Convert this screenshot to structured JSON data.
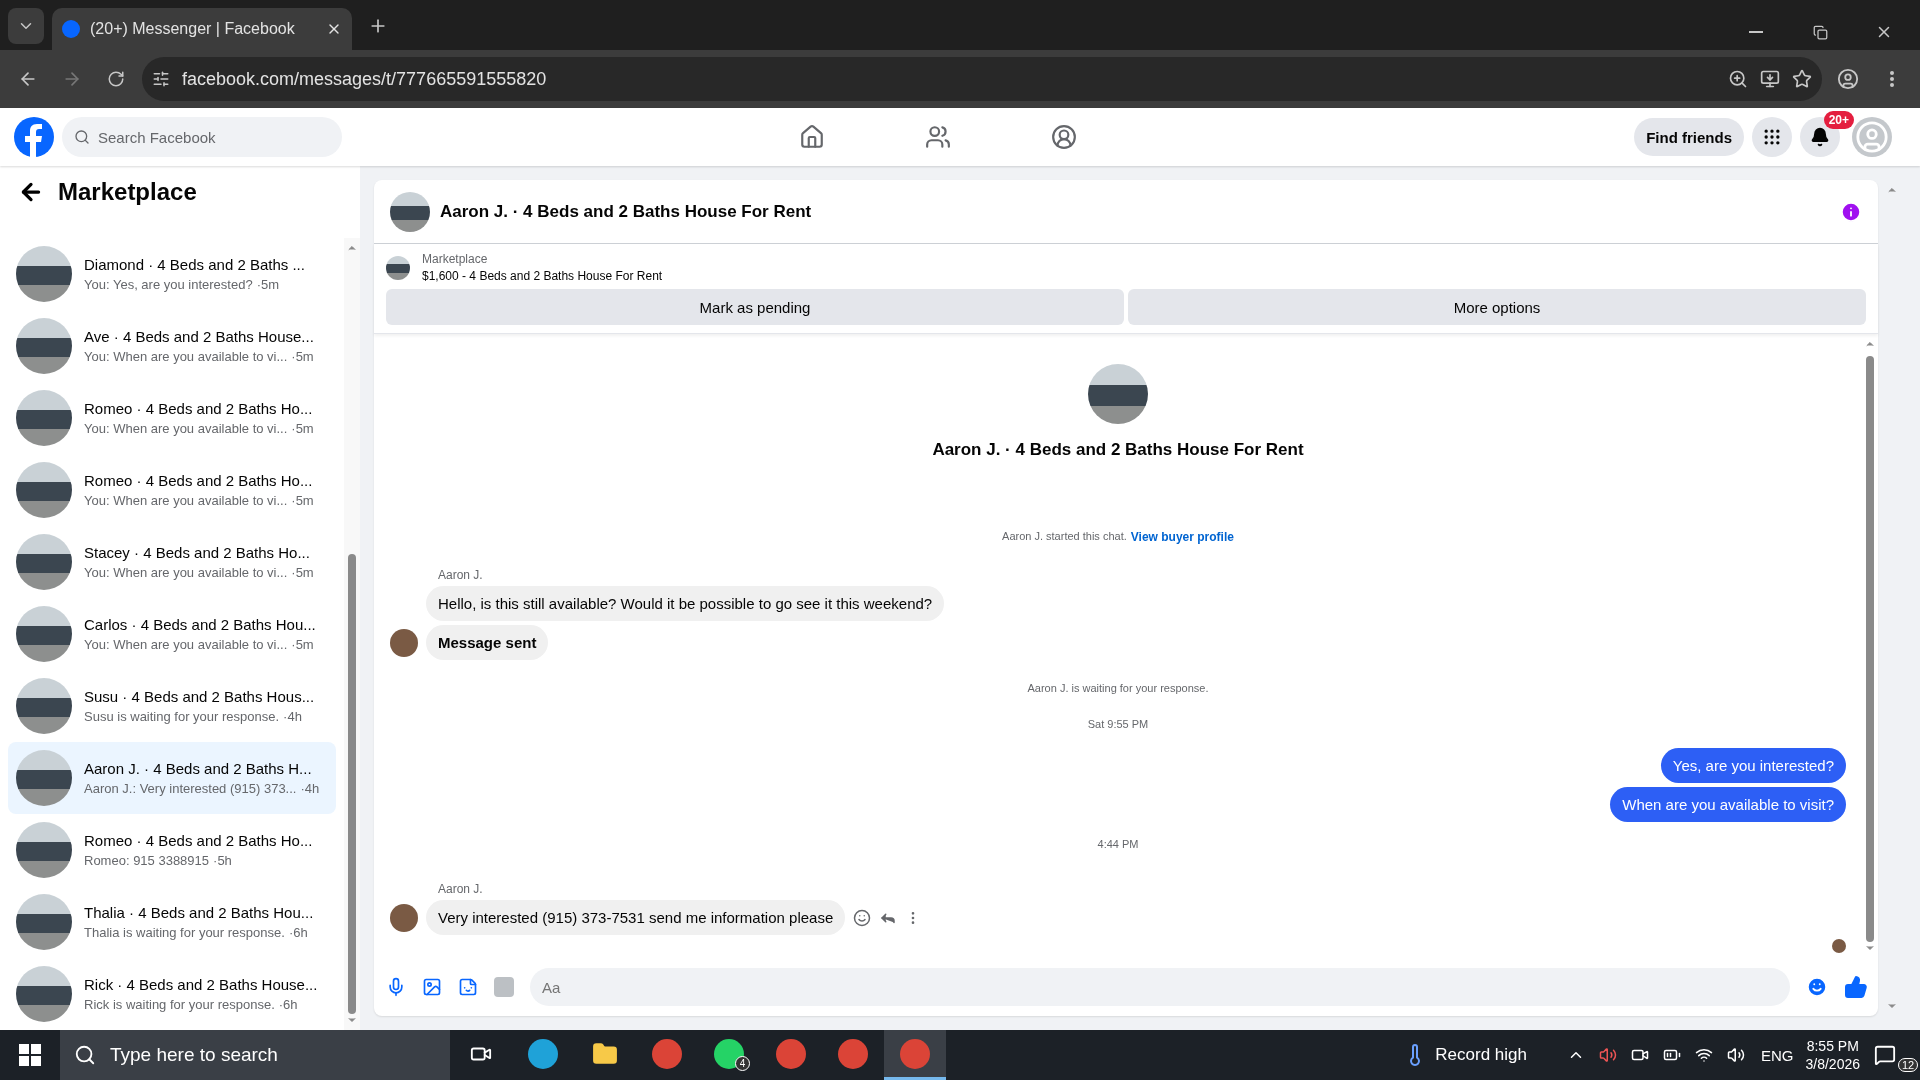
{
  "browser": {
    "tab_title": "(20+) Messenger | Facebook",
    "url": "facebook.com/messages/t/777665591555820"
  },
  "header": {
    "search_placeholder": "Search Facebook",
    "find_friends": "Find friends",
    "notification_badge": "20+"
  },
  "sidebar": {
    "title": "Marketplace",
    "conversations": [
      {
        "title": "Diamond · 4 Beds and 2 Baths ...",
        "preview": "You: Yes, are you interested?",
        "time": "·5m",
        "selected": false
      },
      {
        "title": "Ave · 4 Beds and 2 Baths House...",
        "preview": "You: When are you available to vi...",
        "time": "·5m",
        "selected": false
      },
      {
        "title": "Romeo · 4 Beds and 2 Baths Ho...",
        "preview": "You: When are you available to vi...",
        "time": "·5m",
        "selected": false
      },
      {
        "title": "Romeo · 4 Beds and 2 Baths Ho...",
        "preview": "You: When are you available to vi...",
        "time": "·5m",
        "selected": false
      },
      {
        "title": "Stacey · 4 Beds and 2 Baths Ho...",
        "preview": "You: When are you available to vi...",
        "time": "·5m",
        "selected": false
      },
      {
        "title": "Carlos · 4 Beds and 2 Baths Hou...",
        "preview": "You: When are you available to vi...",
        "time": "·5m",
        "selected": false
      },
      {
        "title": "Susu · 4 Beds and 2 Baths Hous...",
        "preview": "Susu is waiting for your response.",
        "time": "·4h",
        "selected": false
      },
      {
        "title": "Aaron J. · 4 Beds and 2 Baths H...",
        "preview": "Aaron J.: Very interested (915) 373...",
        "time": "·4h",
        "selected": true
      },
      {
        "title": "Romeo · 4 Beds and 2 Baths Ho...",
        "preview": "Romeo: 915 3388915",
        "time": "·5h",
        "selected": false
      },
      {
        "title": "Thalia · 4 Beds and 2 Baths Hou...",
        "preview": "Thalia is waiting for your response.",
        "time": "·6h",
        "selected": false
      },
      {
        "title": "Rick · 4 Beds and 2 Baths House...",
        "preview": "Rick is waiting for your response.",
        "time": "·6h",
        "selected": false
      }
    ]
  },
  "chat": {
    "title": "Aaron J. · 4 Beds and 2 Baths House For Rent",
    "listing": {
      "label": "Marketplace",
      "name": "$1,600 - 4 Beds and 2 Baths House For Rent"
    },
    "buttons": [
      "Mark as pending",
      "More options"
    ],
    "intro_title": "Aaron J. · 4 Beds and 2 Baths House For Rent",
    "messages": [
      {
        "kind": "intro",
        "text": "Aaron J. started this chat.",
        "link": "View buyer profile"
      },
      {
        "kind": "sender",
        "text": "Aaron J."
      },
      {
        "kind": "incoming",
        "text": "Hello, is this still available? Would it be possible to go see it this weekend?",
        "avatar": false,
        "bold": false,
        "actions": false
      },
      {
        "kind": "incoming",
        "text": "Message sent",
        "avatar": true,
        "bold": true,
        "actions": false
      },
      {
        "kind": "system",
        "text": "Aaron J. is waiting for your response."
      },
      {
        "kind": "time",
        "text": "Sat 9:55 PM"
      },
      {
        "kind": "outgoing",
        "text": "Yes, are you interested?"
      },
      {
        "kind": "outgoing",
        "text": "When are you available to visit?"
      },
      {
        "kind": "time",
        "text": "4:44 PM"
      },
      {
        "kind": "sender",
        "text": "Aaron J."
      },
      {
        "kind": "incoming",
        "text": "Very interested  (915) 373-7531 send me information please",
        "avatar": true,
        "bold": false,
        "actions": true
      }
    ],
    "composer_placeholder": "Aa"
  },
  "taskbar": {
    "search_placeholder": "Type here to search",
    "whatsapp_badge": "4",
    "weather": "Record high",
    "language": "ENG",
    "time": "8:55 PM",
    "date": "3/8/2026",
    "notification_count": "12"
  }
}
